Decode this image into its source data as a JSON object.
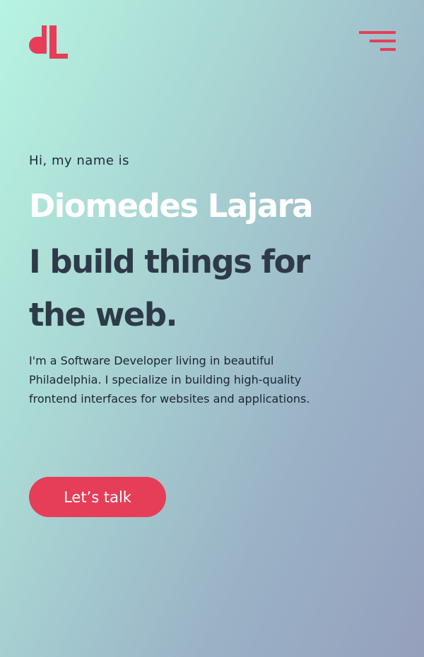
{
  "header": {
    "logo_icon": "dl-monogram-logo",
    "menu_icon": "hamburger-menu-icon",
    "accent_color": "#e63e58"
  },
  "hero": {
    "greeting": "Hi, my name is",
    "name": "Diomedes Lajara",
    "tagline": "I build things for the web.",
    "bio": "I'm a Software Developer living in beautiful Philadelphia. I specialize in building high-quality frontend interfaces for websites and applications.",
    "cta_label": "Let’s talk"
  }
}
